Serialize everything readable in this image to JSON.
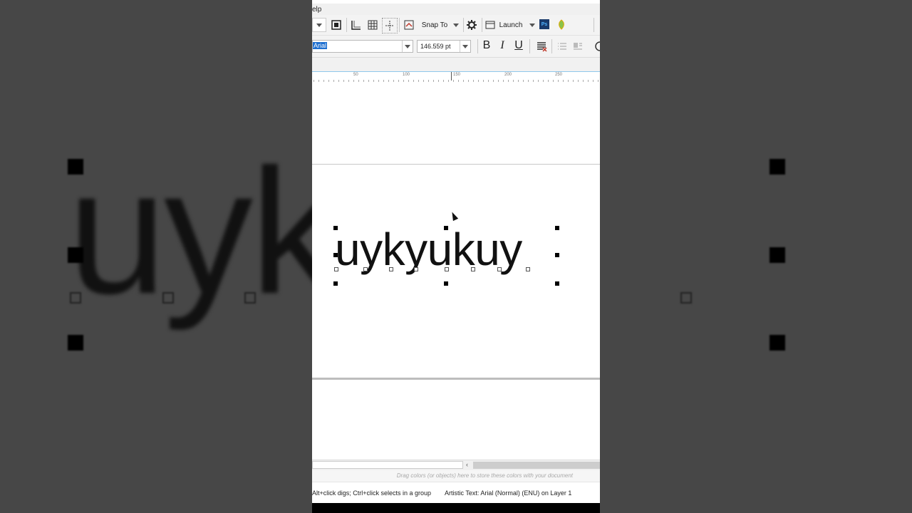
{
  "app": {
    "menu_fragment": "elp"
  },
  "toolbar": {
    "snap_to_label": "Snap To",
    "launch_label": "Launch",
    "ps_label": "Ps"
  },
  "text_props": {
    "font_name": "Arial",
    "font_size": "146.559 pt",
    "bold_label": "B",
    "italic_label": "I",
    "underline_label": "U"
  },
  "ruler": {
    "marks": [
      "50",
      "100",
      "150",
      "200",
      "250"
    ]
  },
  "canvas": {
    "artistic_text": "uykyukuy",
    "background_text": "uyk uy"
  },
  "palette": {
    "hint": "Drag colors (or objects) here to store these colors with your document"
  },
  "status": {
    "hint": "Alt+click digs; Ctrl+click selects in a group",
    "object_info": "Artistic Text: Arial (Normal) (ENU) on Layer 1"
  },
  "colors": {
    "selection": "#1e6fd0",
    "ps_icon": "#1a3a6b",
    "ruler_line": "#8fc7ec"
  }
}
